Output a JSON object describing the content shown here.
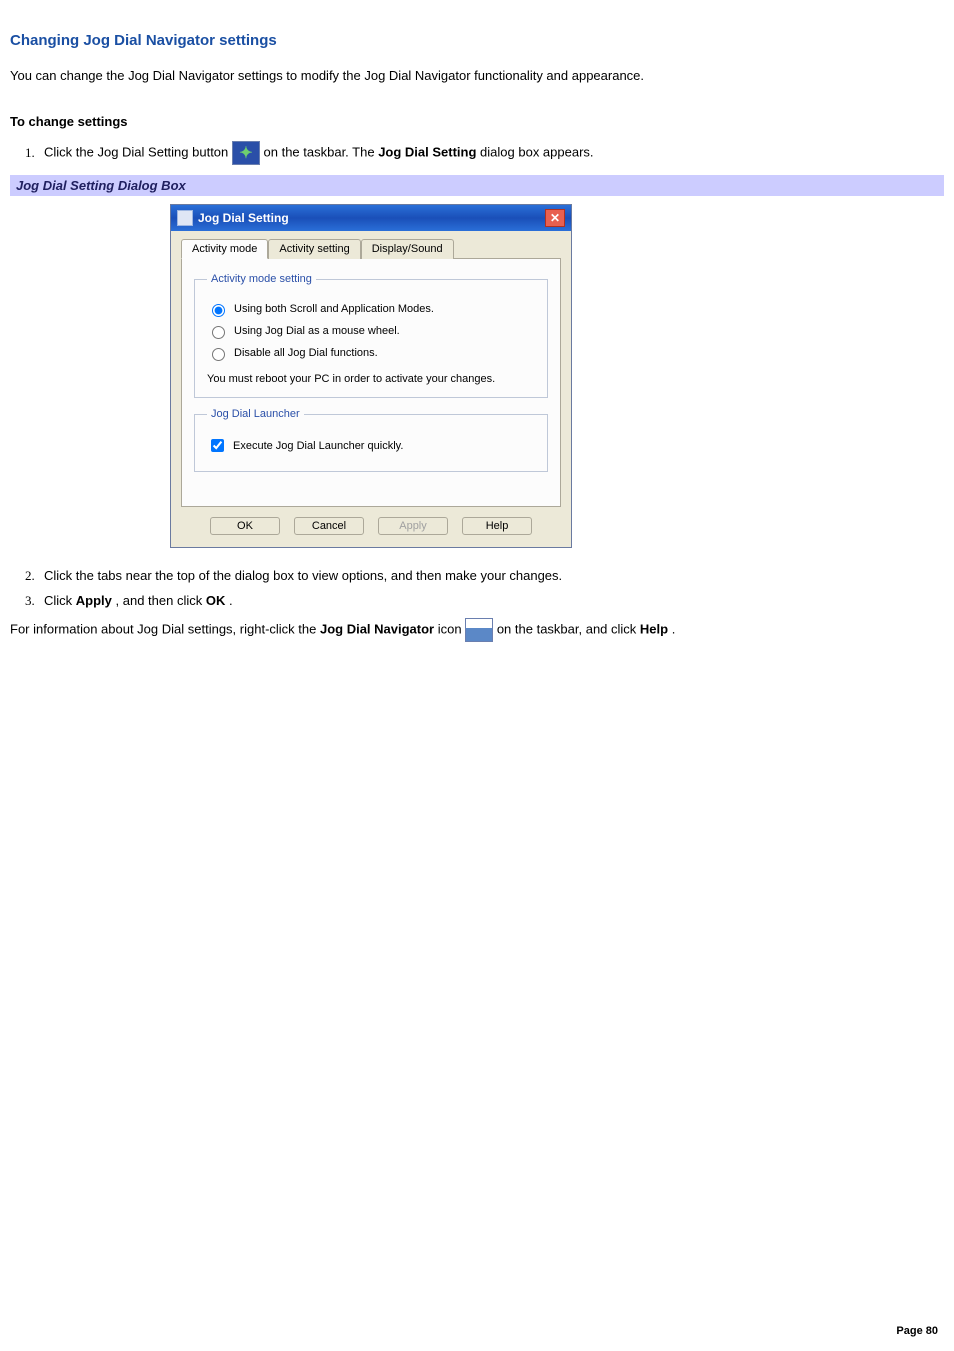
{
  "page": {
    "title": "Changing Jog Dial Navigator settings",
    "intro": "You can change the Jog Dial Navigator settings to modify the Jog Dial Navigator functionality and appearance.",
    "subhead": "To change settings",
    "page_number": "Page 80"
  },
  "steps": {
    "s1a": "Click the Jog Dial Setting button ",
    "s1b": "on the taskbar. The ",
    "s1c": "Jog Dial Setting",
    "s1d": " dialog box appears.",
    "s2": "Click the tabs near the top of the dialog box to view options, and then make your changes.",
    "s3a": "Click ",
    "s3b": "Apply",
    "s3c": ", and then click ",
    "s3d": "OK",
    "s3e": "."
  },
  "caption": "Jog Dial Setting Dialog Box",
  "dialog": {
    "title": "Jog Dial Setting",
    "tabs": [
      "Activity mode",
      "Activity setting",
      "Display/Sound"
    ],
    "groups": {
      "mode_legend": "Activity mode setting",
      "launcher_legend": "Jog Dial Launcher"
    },
    "radios": {
      "r1": "Using both Scroll and Application Modes.",
      "r2": "Using Jog Dial as a mouse wheel.",
      "r3": "Disable all Jog Dial functions."
    },
    "mode_note": "You must reboot your PC in order to activate your changes.",
    "checkbox": "Execute Jog Dial Launcher quickly.",
    "buttons": {
      "ok": "OK",
      "cancel": "Cancel",
      "apply": "Apply",
      "help": "Help"
    }
  },
  "footer": {
    "a": "For information about Jog Dial settings, right-click the ",
    "b": "Jog Dial Navigator",
    "c": " icon ",
    "d": "on the taskbar, and click ",
    "e": "Help",
    "f": "."
  }
}
